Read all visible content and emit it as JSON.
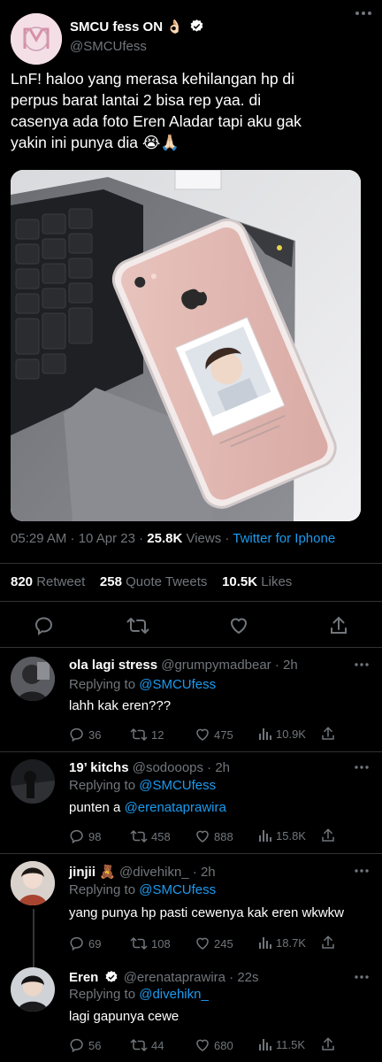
{
  "main_tweet": {
    "author_name": "SMCU fess ON 👌🏻",
    "handle": "@SMCUfess",
    "text_lines": [
      "LnF! haloo yang merasa kehilangan hp di",
      "perpus barat lantai 2 bisa rep yaa. di",
      "casenya ada foto Eren Aladar tapi aku gak",
      "yakin ini punya dia 😭🙏🏻"
    ],
    "time": "05:29 AM · 10 Apr 23 · ",
    "views_count": "25.8K",
    "views_label": " Views · ",
    "source": "Twitter for Iphone",
    "retweets_count": "820",
    "retweets_label": "Retweet",
    "quotes_count": "258",
    "quotes_label": "Quote Tweets",
    "likes_count": "10.5K",
    "likes_label": "Likes"
  },
  "replies": [
    {
      "name": "ola lagi stress",
      "meta": "@grumpymadbear · 2h",
      "replying_prefix": "Replying to ",
      "replying_to": "@SMCUfess",
      "text": "lahh kak eren???",
      "text_link": "",
      "replies": "36",
      "retweets": "12",
      "likes": "475",
      "views": "10.9K"
    },
    {
      "name": "19’ kitchs",
      "meta": "@sodooops · 2h",
      "replying_prefix": "Replying to ",
      "replying_to": "@SMCUfess",
      "text": "punten a ",
      "text_link": "@erenataprawira",
      "replies": "98",
      "retweets": "458",
      "likes": "888",
      "views": "15.8K"
    },
    {
      "name": "jinjii 🧸",
      "meta": "@divehikn_ · 2h",
      "replying_prefix": "Replying to ",
      "replying_to": "@SMCUfess",
      "text": "yang punya hp pasti cewenya kak eren wkwkw",
      "text_link": "",
      "replies": "69",
      "retweets": "108",
      "likes": "245",
      "views": "18.7K"
    },
    {
      "name": "Eren",
      "meta": "@erenataprawira · 22s",
      "replying_prefix": "Replying to ",
      "replying_to": "@divehikn_",
      "text": "lagi gapunya cewe",
      "text_link": "",
      "replies": "56",
      "retweets": "44",
      "likes": "680",
      "views": "11.5K"
    }
  ],
  "colors": {
    "background": "#000000",
    "accent": "#1d9bf0",
    "muted": "#71767b",
    "verified": "#ffffff"
  }
}
